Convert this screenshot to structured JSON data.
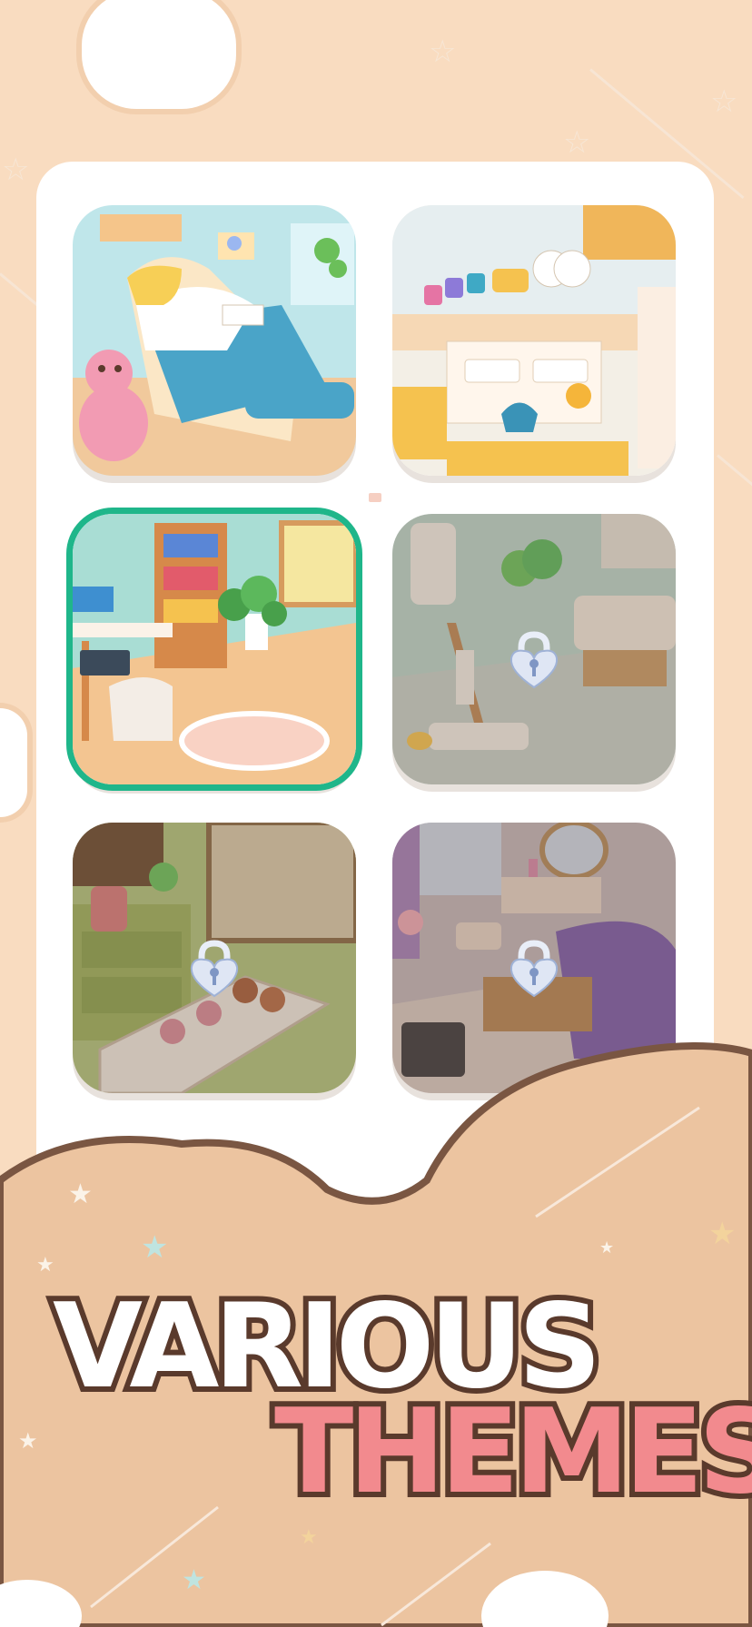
{
  "headline": {
    "line1": "VARIOUS",
    "line2": "THEMES"
  },
  "colors": {
    "background": "#f9dcc0",
    "panel": "#ffffff",
    "selected_border": "#1fb68a",
    "wave": "#ecc4a0",
    "wave_outline": "#7a5642",
    "title_stroke": "#5a3a2c",
    "themes_fill": "#f28a8e"
  },
  "themes": [
    {
      "name": "bedroom-theme",
      "locked": false,
      "selected": false
    },
    {
      "name": "kitchen-theme",
      "locked": false,
      "selected": false
    },
    {
      "name": "study-theme",
      "locked": false,
      "selected": true
    },
    {
      "name": "bathroom-theme",
      "locked": true,
      "selected": false
    },
    {
      "name": "bakery-theme",
      "locked": true,
      "selected": false
    },
    {
      "name": "purple-bedroom-theme",
      "locked": true,
      "selected": false
    }
  ],
  "icons": {
    "lock": "padlock-heart-icon",
    "star": "star-icon",
    "cloud": "cloud-icon"
  }
}
